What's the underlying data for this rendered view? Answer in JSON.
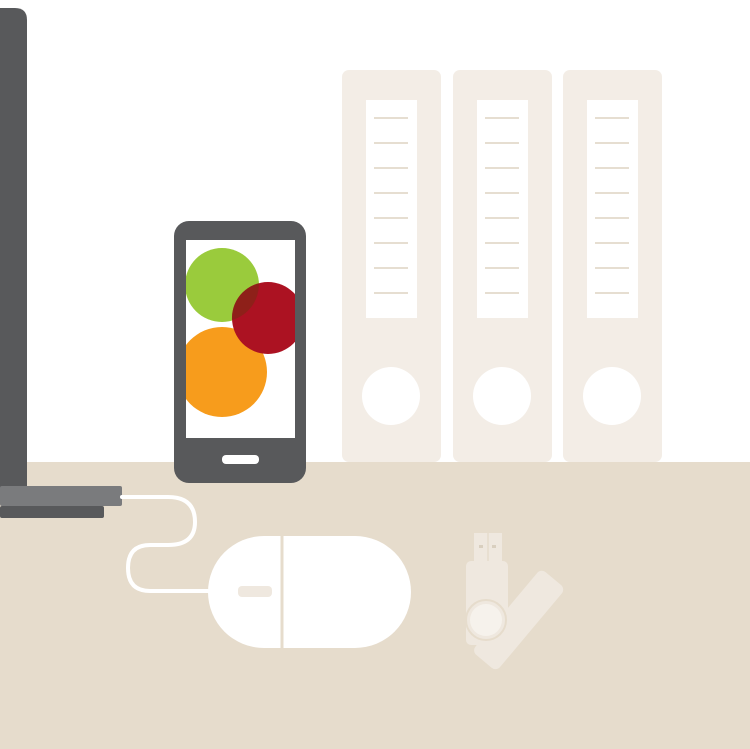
{
  "scene": {
    "description_free": true
  },
  "colors": {
    "wall": "#ffffff",
    "desk": "#e6dccc",
    "binder": "#f3ede6",
    "binder_line": "#ddd3c2",
    "device_dark": "#58595b",
    "device_mid": "#7a7b7d",
    "phone_green": "#9acb3c",
    "phone_red": "#ac1222",
    "phone_orange": "#f79c1c",
    "mouse": "#ffffff",
    "usb": "#efe8df"
  },
  "icons": [
    "monitor-stand-icon",
    "smartphone-icon",
    "binder-icon",
    "mouse-icon",
    "usb-drive-icon"
  ],
  "binders": [
    {
      "name": "binder-1",
      "label_lines": 8
    },
    {
      "name": "binder-2",
      "label_lines": 8
    },
    {
      "name": "binder-3",
      "label_lines": 8
    }
  ]
}
